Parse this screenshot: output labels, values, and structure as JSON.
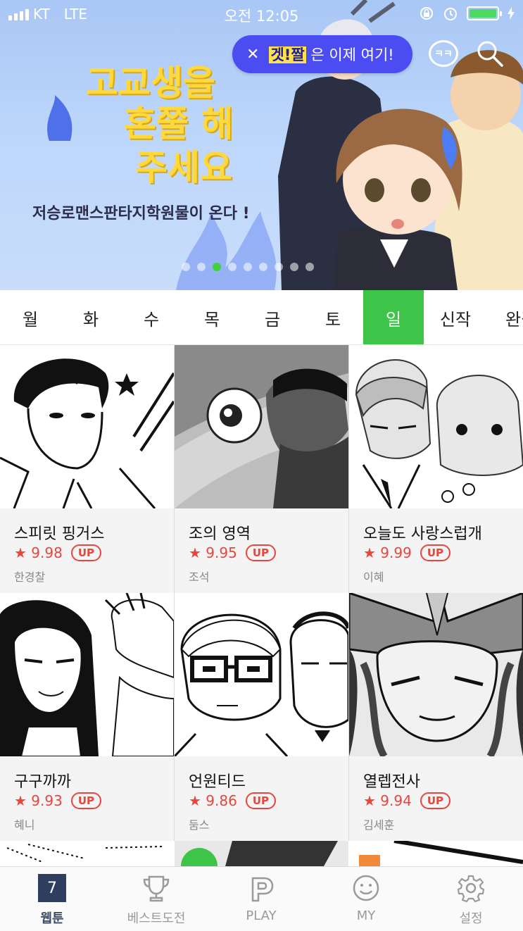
{
  "status_bar": {
    "carrier": "KT",
    "network": "LTE",
    "time": "오전 12:05"
  },
  "promo": {
    "close": "✕",
    "highlight": "겟!짤",
    "text": "은 이제 여기!"
  },
  "icons": {
    "chat": "ㅋㅋ",
    "search": "search-icon"
  },
  "banner": {
    "headline_1": "고교생을",
    "headline_2": "혼쭐 해",
    "headline_3": "주세요",
    "subtitle": "저승로맨스판타지학원물이 온다 !",
    "dot_count": 10,
    "active_dot": 2
  },
  "day_tabs": [
    {
      "label": "월"
    },
    {
      "label": "화"
    },
    {
      "label": "수"
    },
    {
      "label": "목"
    },
    {
      "label": "금"
    },
    {
      "label": "토"
    },
    {
      "label": "일",
      "active": true
    },
    {
      "label": "신작"
    },
    {
      "label": "완결"
    }
  ],
  "comics": [
    {
      "title": "스피릿 핑거스",
      "rating": "★ 9.98",
      "badge": "UP",
      "author": "한경찰"
    },
    {
      "title": "조의 영역",
      "rating": "★ 9.95",
      "badge": "UP",
      "author": "조석"
    },
    {
      "title": "오늘도 사랑스럽개",
      "rating": "★ 9.99",
      "badge": "UP",
      "author": "이혜"
    },
    {
      "title": "구구까까",
      "rating": "★ 9.93",
      "badge": "UP",
      "author": "혜니"
    },
    {
      "title": "언원티드",
      "rating": "★ 9.86",
      "badge": "UP",
      "author": "둠스"
    },
    {
      "title": "열렙전사",
      "rating": "★ 9.94",
      "badge": "UP",
      "author": "김세훈"
    }
  ],
  "bottom_nav": [
    {
      "label": "웹툰",
      "icon": "calendar-icon",
      "calendar_day": "7",
      "active": true
    },
    {
      "label": "베스트도전",
      "icon": "trophy-icon"
    },
    {
      "label": "PLAY",
      "icon": "play-icon"
    },
    {
      "label": "MY",
      "icon": "smiley-icon"
    },
    {
      "label": "설정",
      "icon": "gear-icon"
    }
  ],
  "colors": {
    "accent_green": "#3fc44a",
    "promo_blue": "#4b4df2",
    "rating_red": "#e8453c",
    "nav_dark": "#2f3d5e"
  }
}
